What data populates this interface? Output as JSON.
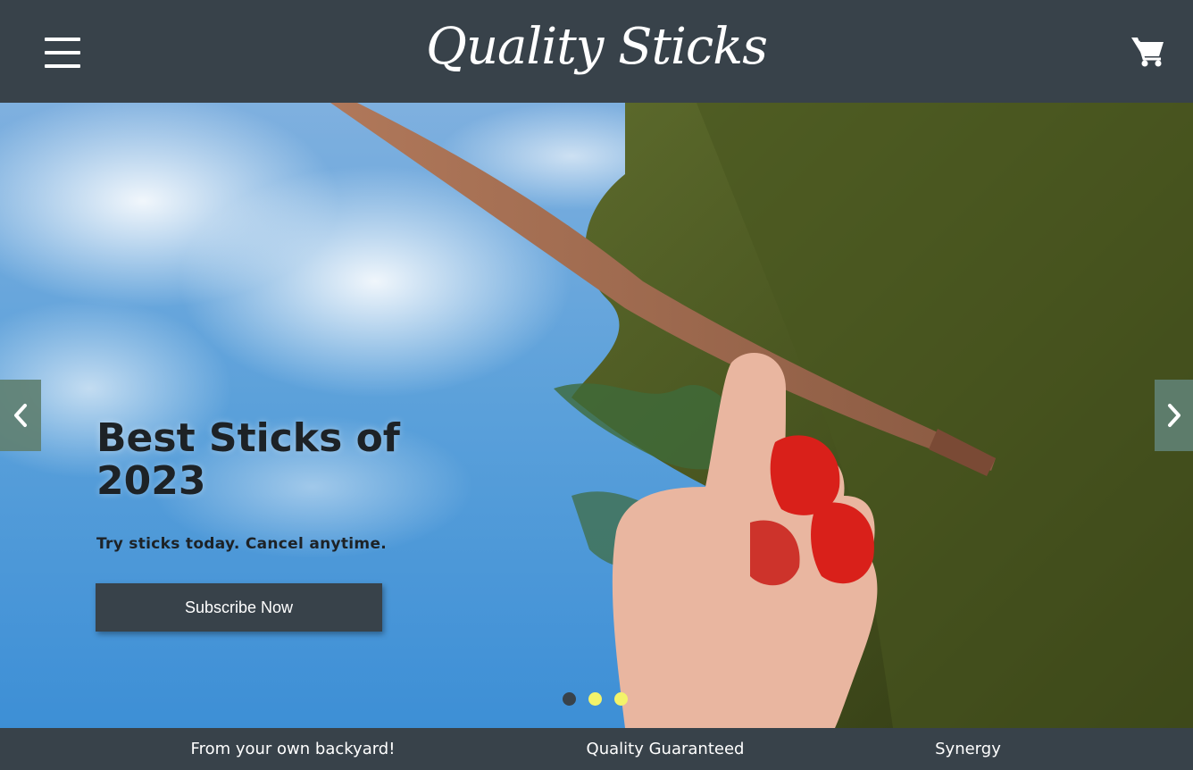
{
  "header": {
    "logo_text": "Quality Sticks",
    "menu_icon": "hamburger-menu-icon",
    "cart_icon": "shopping-cart-icon"
  },
  "hero": {
    "title": "Best Sticks of 2023",
    "subtitle": "Try sticks today. Cancel anytime.",
    "cta_label": "Subscribe Now",
    "prev_icon": "chevron-left-icon",
    "next_icon": "chevron-right-icon",
    "slide_indicators": [
      {
        "active": true
      },
      {
        "active": false
      },
      {
        "active": false
      }
    ]
  },
  "features": [
    "From your own backyard!",
    "Quality Guaranteed",
    "Synergy"
  ],
  "colors": {
    "header_bg": "#38424a",
    "arrow_bg": "#608072",
    "dot_active": "#38424a",
    "dot_inactive": "#f3f36a",
    "text_dark": "#1d2226"
  }
}
